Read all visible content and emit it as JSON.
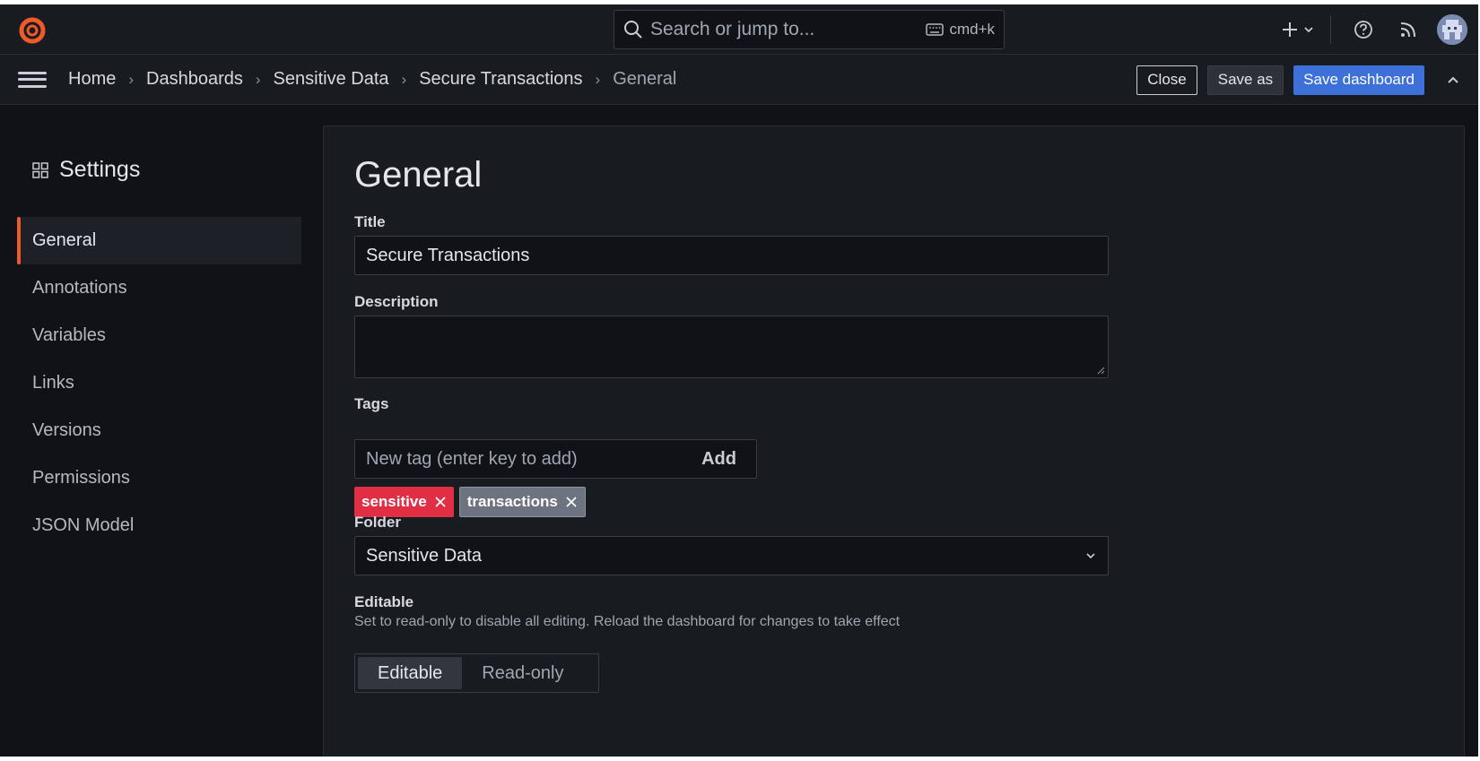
{
  "topbar": {
    "search_placeholder": "Search or jump to...",
    "search_shortcut": "cmd+k",
    "logo_icon": "grafana-logo-icon",
    "brand_color": "#f05a28"
  },
  "breadcrumb": {
    "items": [
      "Home",
      "Dashboards",
      "Sensitive Data",
      "Secure Transactions",
      "General"
    ]
  },
  "actions": {
    "close_label": "Close",
    "save_as_label": "Save as",
    "save_label": "Save dashboard"
  },
  "sidebar": {
    "title": "Settings",
    "items": [
      {
        "label": "General",
        "active": true
      },
      {
        "label": "Annotations",
        "active": false
      },
      {
        "label": "Variables",
        "active": false
      },
      {
        "label": "Links",
        "active": false
      },
      {
        "label": "Versions",
        "active": false
      },
      {
        "label": "Permissions",
        "active": false
      },
      {
        "label": "JSON Model",
        "active": false
      }
    ]
  },
  "form": {
    "heading": "General",
    "title_label": "Title",
    "title_value": "Secure Transactions",
    "description_label": "Description",
    "description_value": "",
    "tags_label": "Tags",
    "tag_placeholder": "New tag (enter key to add)",
    "tag_add_label": "Add",
    "tags": [
      {
        "label": "sensitive",
        "color": "#e02f44"
      },
      {
        "label": "transactions",
        "color": "#6e7380"
      }
    ],
    "folder_label": "Folder",
    "folder_value": "Sensitive Data",
    "editable_label": "Editable",
    "editable_help": "Set to read-only to disable all editing. Reload the dashboard for changes to take effect",
    "editable_options": [
      "Editable",
      "Read-only"
    ],
    "editable_selected": "Editable"
  }
}
